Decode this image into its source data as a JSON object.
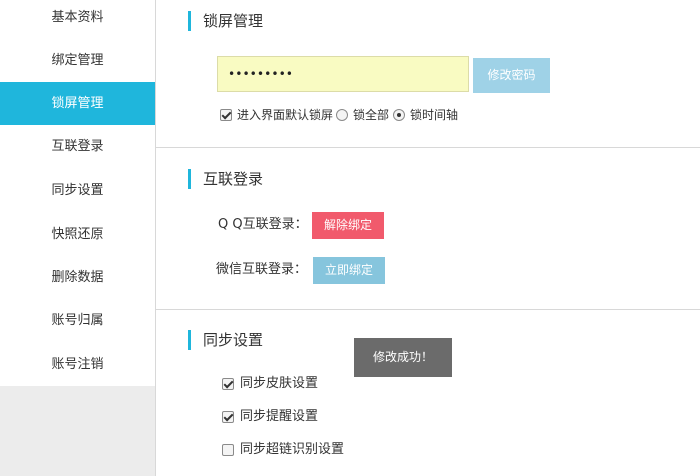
{
  "sidebar": {
    "items": [
      {
        "label": "基本资料"
      },
      {
        "label": "绑定管理"
      },
      {
        "label": "锁屏管理"
      },
      {
        "label": "互联登录"
      },
      {
        "label": "同步设置"
      },
      {
        "label": "快照还原"
      },
      {
        "label": "删除数据"
      },
      {
        "label": "账号归属"
      },
      {
        "label": "账号注销"
      }
    ],
    "active_index": 2
  },
  "lock_screen": {
    "title": "锁屏管理",
    "password_value": "•••••••••",
    "change_button": "修改密码",
    "default_lock_label": "进入界面默认锁屏",
    "default_lock_checked": true,
    "lock_all_label": "锁全部",
    "lock_timeline_label": "锁时间轴",
    "selected_mode": "锁时间轴"
  },
  "linked_login": {
    "title": "互联登录",
    "qq_label": "Q Q互联登录：",
    "qq_button": "解除绑定",
    "wechat_label": "微信互联登录：",
    "wechat_button": "立即绑定"
  },
  "sync": {
    "title": "同步设置",
    "options": [
      {
        "label": "同步皮肤设置",
        "checked": true
      },
      {
        "label": "同步提醒设置",
        "checked": true
      },
      {
        "label": "同步超链识别设置",
        "checked": false
      }
    ]
  },
  "toast": {
    "text": "修改成功！"
  },
  "colors": {
    "accent": "#1fb6dc",
    "unbind": "#f15a6c",
    "bind": "#86c5dd",
    "change": "#9fd2e7",
    "input_bg": "#f9fbc2",
    "toast_bg": "#6b6b6b"
  }
}
